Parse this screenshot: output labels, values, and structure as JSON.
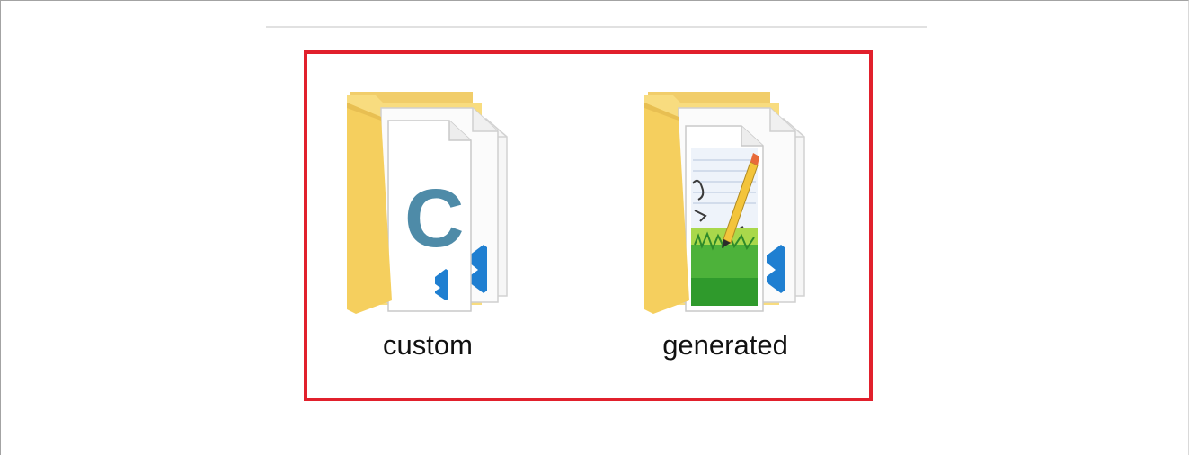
{
  "folders": [
    {
      "name": "custom",
      "icon": "folder-csharp-vscode-icon"
    },
    {
      "name": "generated",
      "icon": "folder-image-vscode-icon"
    }
  ],
  "colors": {
    "highlight": "#e1202c",
    "folder": "#f7d674",
    "folder_shade": "#e8bf52",
    "csharp": "#4e8ba8",
    "vscode": "#1f7fd1"
  }
}
